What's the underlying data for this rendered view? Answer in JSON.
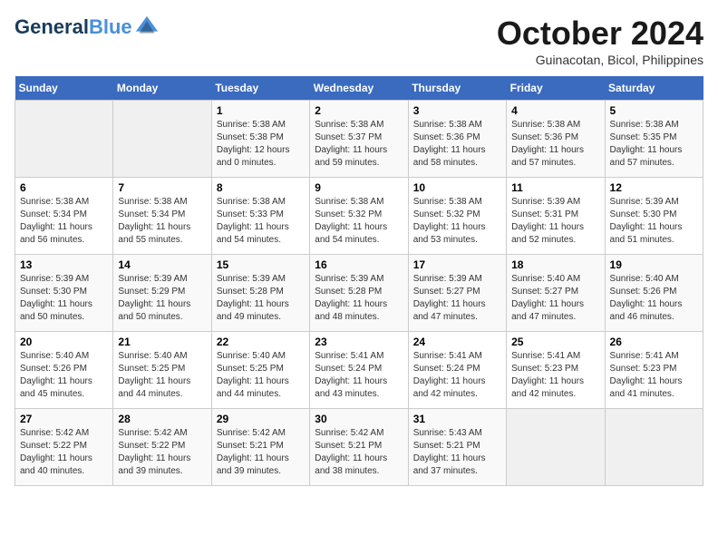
{
  "header": {
    "logo_line1": "General",
    "logo_line2": "Blue",
    "month_title": "October 2024",
    "subtitle": "Guinacotan, Bicol, Philippines"
  },
  "days_of_week": [
    "Sunday",
    "Monday",
    "Tuesday",
    "Wednesday",
    "Thursday",
    "Friday",
    "Saturday"
  ],
  "weeks": [
    [
      {
        "day": "",
        "empty": true
      },
      {
        "day": "",
        "empty": true
      },
      {
        "day": "1",
        "sunrise": "5:38 AM",
        "sunset": "5:38 PM",
        "daylight": "12 hours and 0 minutes."
      },
      {
        "day": "2",
        "sunrise": "5:38 AM",
        "sunset": "5:37 PM",
        "daylight": "11 hours and 59 minutes."
      },
      {
        "day": "3",
        "sunrise": "5:38 AM",
        "sunset": "5:36 PM",
        "daylight": "11 hours and 58 minutes."
      },
      {
        "day": "4",
        "sunrise": "5:38 AM",
        "sunset": "5:36 PM",
        "daylight": "11 hours and 57 minutes."
      },
      {
        "day": "5",
        "sunrise": "5:38 AM",
        "sunset": "5:35 PM",
        "daylight": "11 hours and 57 minutes."
      }
    ],
    [
      {
        "day": "6",
        "sunrise": "5:38 AM",
        "sunset": "5:34 PM",
        "daylight": "11 hours and 56 minutes."
      },
      {
        "day": "7",
        "sunrise": "5:38 AM",
        "sunset": "5:34 PM",
        "daylight": "11 hours and 55 minutes."
      },
      {
        "day": "8",
        "sunrise": "5:38 AM",
        "sunset": "5:33 PM",
        "daylight": "11 hours and 54 minutes."
      },
      {
        "day": "9",
        "sunrise": "5:38 AM",
        "sunset": "5:32 PM",
        "daylight": "11 hours and 54 minutes."
      },
      {
        "day": "10",
        "sunrise": "5:38 AM",
        "sunset": "5:32 PM",
        "daylight": "11 hours and 53 minutes."
      },
      {
        "day": "11",
        "sunrise": "5:39 AM",
        "sunset": "5:31 PM",
        "daylight": "11 hours and 52 minutes."
      },
      {
        "day": "12",
        "sunrise": "5:39 AM",
        "sunset": "5:30 PM",
        "daylight": "11 hours and 51 minutes."
      }
    ],
    [
      {
        "day": "13",
        "sunrise": "5:39 AM",
        "sunset": "5:30 PM",
        "daylight": "11 hours and 50 minutes."
      },
      {
        "day": "14",
        "sunrise": "5:39 AM",
        "sunset": "5:29 PM",
        "daylight": "11 hours and 50 minutes."
      },
      {
        "day": "15",
        "sunrise": "5:39 AM",
        "sunset": "5:28 PM",
        "daylight": "11 hours and 49 minutes."
      },
      {
        "day": "16",
        "sunrise": "5:39 AM",
        "sunset": "5:28 PM",
        "daylight": "11 hours and 48 minutes."
      },
      {
        "day": "17",
        "sunrise": "5:39 AM",
        "sunset": "5:27 PM",
        "daylight": "11 hours and 47 minutes."
      },
      {
        "day": "18",
        "sunrise": "5:40 AM",
        "sunset": "5:27 PM",
        "daylight": "11 hours and 47 minutes."
      },
      {
        "day": "19",
        "sunrise": "5:40 AM",
        "sunset": "5:26 PM",
        "daylight": "11 hours and 46 minutes."
      }
    ],
    [
      {
        "day": "20",
        "sunrise": "5:40 AM",
        "sunset": "5:26 PM",
        "daylight": "11 hours and 45 minutes."
      },
      {
        "day": "21",
        "sunrise": "5:40 AM",
        "sunset": "5:25 PM",
        "daylight": "11 hours and 44 minutes."
      },
      {
        "day": "22",
        "sunrise": "5:40 AM",
        "sunset": "5:25 PM",
        "daylight": "11 hours and 44 minutes."
      },
      {
        "day": "23",
        "sunrise": "5:41 AM",
        "sunset": "5:24 PM",
        "daylight": "11 hours and 43 minutes."
      },
      {
        "day": "24",
        "sunrise": "5:41 AM",
        "sunset": "5:24 PM",
        "daylight": "11 hours and 42 minutes."
      },
      {
        "day": "25",
        "sunrise": "5:41 AM",
        "sunset": "5:23 PM",
        "daylight": "11 hours and 42 minutes."
      },
      {
        "day": "26",
        "sunrise": "5:41 AM",
        "sunset": "5:23 PM",
        "daylight": "11 hours and 41 minutes."
      }
    ],
    [
      {
        "day": "27",
        "sunrise": "5:42 AM",
        "sunset": "5:22 PM",
        "daylight": "11 hours and 40 minutes."
      },
      {
        "day": "28",
        "sunrise": "5:42 AM",
        "sunset": "5:22 PM",
        "daylight": "11 hours and 39 minutes."
      },
      {
        "day": "29",
        "sunrise": "5:42 AM",
        "sunset": "5:21 PM",
        "daylight": "11 hours and 39 minutes."
      },
      {
        "day": "30",
        "sunrise": "5:42 AM",
        "sunset": "5:21 PM",
        "daylight": "11 hours and 38 minutes."
      },
      {
        "day": "31",
        "sunrise": "5:43 AM",
        "sunset": "5:21 PM",
        "daylight": "11 hours and 37 minutes."
      },
      {
        "day": "",
        "empty": true
      },
      {
        "day": "",
        "empty": true
      }
    ]
  ],
  "labels": {
    "sunrise": "Sunrise:",
    "sunset": "Sunset:",
    "daylight": "Daylight:"
  }
}
